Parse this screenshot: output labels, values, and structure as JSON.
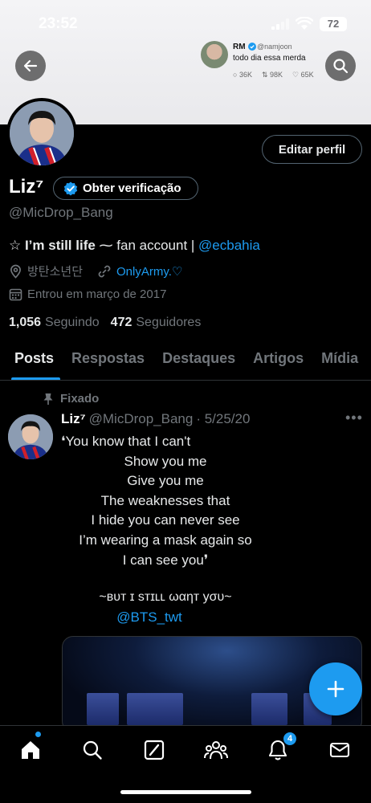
{
  "status_bar": {
    "time": "23:52",
    "battery": "72"
  },
  "embedded_tweet": {
    "name": "RM",
    "handle": "@namjoon",
    "text": "todo dia essa merda",
    "replies": "36K",
    "retweets": "98K",
    "likes": "65K"
  },
  "profile": {
    "edit_label": "Editar perfil",
    "display_name": "Liz⁷",
    "verify_label": "Obter verificação",
    "handle": "@MicDrop_Bang",
    "bio_bold": "☆ I’m still life",
    "bio_rest": " ⁓ fan account | ",
    "bio_link": "@ecbahia",
    "location": "방탄소년단",
    "website": "OnlyArmy.♡",
    "joined": "Entrou em março de 2017",
    "following_count": "1,056",
    "following_label": "Seguindo",
    "followers_count": "472",
    "followers_label": "Seguidores"
  },
  "tabs": [
    "Posts",
    "Respostas",
    "Destaques",
    "Artigos",
    "Mídia"
  ],
  "post": {
    "pinned_label": "Fixado",
    "name": "Liz⁷",
    "handle": "@MicDrop_Bang",
    "date": "· 5/25/20",
    "lines": [
      "❛You know that I can't",
      "Show you me",
      "Give you me",
      "The weaknesses that",
      "I hide you can never see",
      "I’m wearing a mask again so",
      "I can see you❜"
    ],
    "tagline": "~ʙᴜᴛ ɪ sᴛɪʟʟ ωαηт уσυ~",
    "mention": "@BTS_twt"
  },
  "bottom_nav": {
    "notification_badge": "4"
  },
  "colors": {
    "accent": "#1d9bf0",
    "background": "#000000",
    "muted": "#71767b"
  }
}
